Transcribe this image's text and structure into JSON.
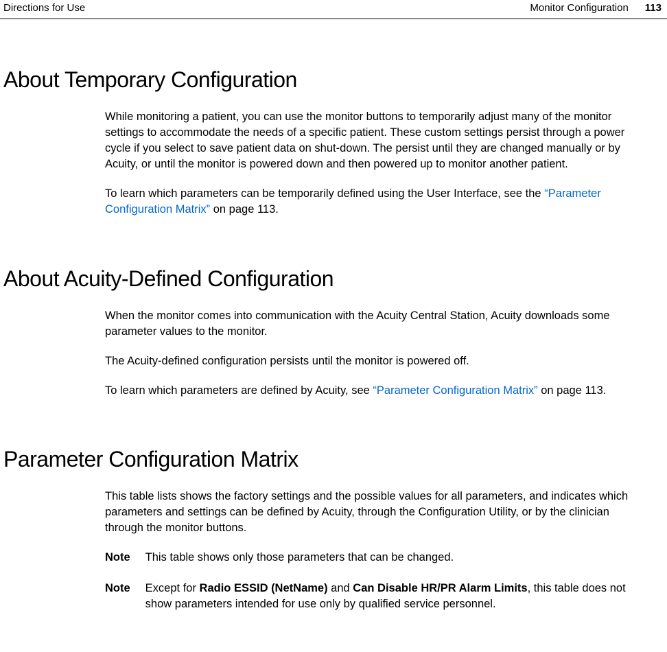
{
  "header": {
    "left": "Directions for Use",
    "section": "Monitor Configuration",
    "page": "113"
  },
  "s1": {
    "title": "About Temporary Configuration",
    "p1": "While monitoring a patient, you can use the monitor buttons to temporarily adjust many of the monitor settings to accommodate the needs of a specific patient. These custom settings persist through a power cycle if you select to save patient data on shut-down. The persist until they are changed manually or by Acuity, or until the monitor is powered down and then powered up to monitor another patient.",
    "p2a": "To learn which parameters can be temporarily defined using the User Interface, see the ",
    "p2link": "“Parameter Configuration Matrix”",
    "p2b": " on page 113."
  },
  "s2": {
    "title": "About Acuity-Defined Configuration",
    "p1": "When the monitor comes into communication with the Acuity Central Station, Acuity downloads some parameter values to the monitor.",
    "p2": "The Acuity-defined configuration persists until the monitor is powered off.",
    "p3a": "To learn which parameters are defined by Acuity, see ",
    "p3link": "“Parameter Configuration Matrix”",
    "p3b": " on page 113."
  },
  "s3": {
    "title": "Parameter Configuration Matrix",
    "p1": "This table lists shows the factory settings and the possible values for all parameters, and indicates which parameters and settings can be defined by Acuity, through the Configuration Utility, or by the clinician through the monitor buttons.",
    "note1_label": "Note",
    "note1_text": "This table shows only those parameters that can be changed.",
    "note2_label": "Note",
    "note2_a": "Except for ",
    "note2_b1": "Radio ESSID (NetName)",
    "note2_mid": " and ",
    "note2_b2": "Can Disable HR/PR Alarm Limits",
    "note2_c": ", this table does not show parameters intended for use only by qualified service personnel."
  }
}
